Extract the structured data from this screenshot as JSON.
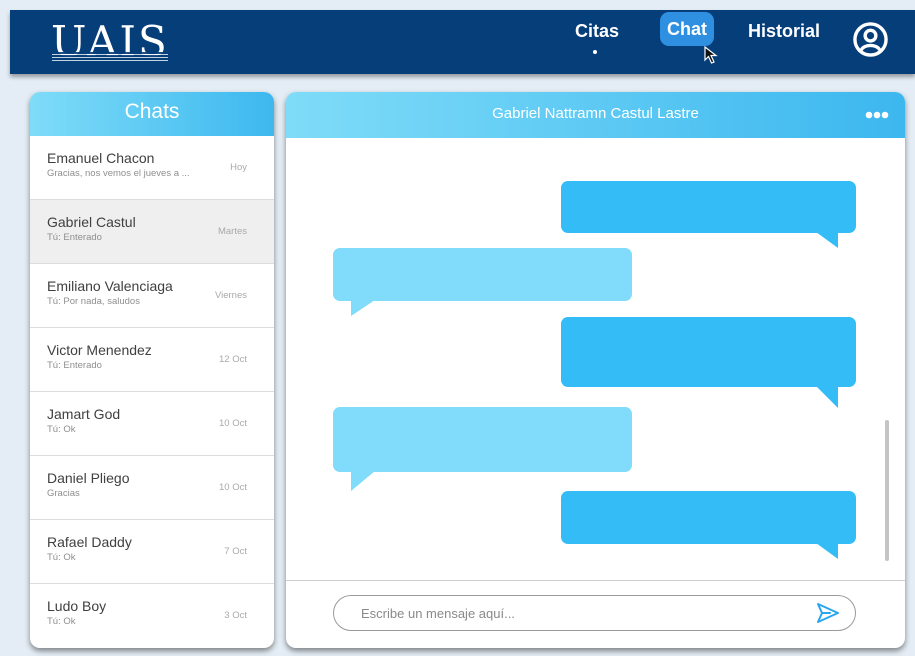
{
  "header": {
    "logo": "UAIS",
    "nav": {
      "citas": "Citas",
      "chat": "Chat",
      "historial": "Historial"
    },
    "active_nav": "Chat",
    "user_icon": "user-circle-icon"
  },
  "chats": {
    "title": "Chats",
    "items": [
      {
        "name": "Emanuel Chacon",
        "preview": "Gracias, nos vemos el jueves a ...",
        "date": "Hoy"
      },
      {
        "name": "Gabriel Castul",
        "preview": "Tú: Enterado",
        "date": "Martes"
      },
      {
        "name": "Emiliano Valenciaga",
        "preview": "Tú: Por nada, saludos",
        "date": "Viernes"
      },
      {
        "name": "Victor Menendez",
        "preview": "Tú: Enterado",
        "date": "12 Oct"
      },
      {
        "name": "Jamart God",
        "preview": "Tú: Ok",
        "date": "10 Oct"
      },
      {
        "name": "Daniel Pliego",
        "preview": "Gracias",
        "date": "10 Oct"
      },
      {
        "name": "Rafael Daddy",
        "preview": "Tú: Ok",
        "date": "7 Oct"
      },
      {
        "name": "Ludo Boy",
        "preview": "Tú: Ok",
        "date": "3 Oct"
      }
    ],
    "selected": "Gabriel Castul"
  },
  "conversation": {
    "contact_name": "Gabriel Nattramn Castul Lastre",
    "more_icon": "more-horizontal-icon",
    "messages": [
      {
        "direction": "outgoing",
        "text": ""
      },
      {
        "direction": "incoming",
        "text": ""
      },
      {
        "direction": "outgoing",
        "text": ""
      },
      {
        "direction": "incoming",
        "text": ""
      },
      {
        "direction": "outgoing",
        "text": ""
      }
    ],
    "input_placeholder": "Escribe un mensaje aquí...",
    "send_icon": "send-icon"
  },
  "colors": {
    "topbar": "#063e7a",
    "active_nav": "#2f8fe0",
    "header_gradient_light": "#7fdcf8",
    "header_gradient_dark": "#3cb7ef",
    "bubble_outgoing": "#34bcf6",
    "bubble_incoming": "#80dcfa",
    "selected_row": "#efefef",
    "page_background": "#e4edf5"
  }
}
